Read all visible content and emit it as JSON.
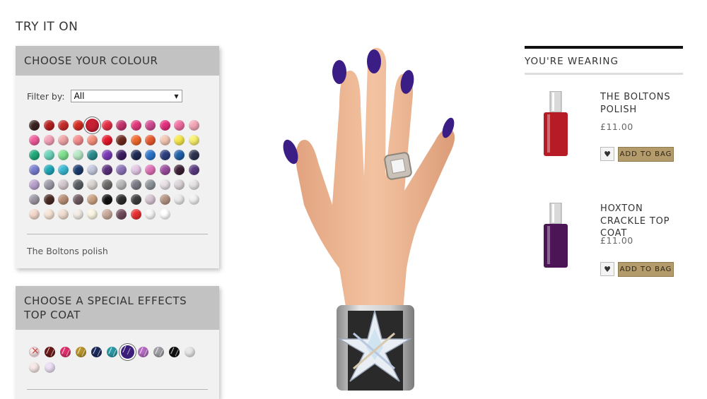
{
  "page": {
    "title": "TRY IT ON"
  },
  "colour_panel": {
    "header": "CHOOSE YOUR COLOUR",
    "filter_label": "Filter by:",
    "filter_value": "All",
    "selected_name": "The Boltons polish",
    "swatch_rows": [
      [
        "#3a2220",
        "#b51f1f",
        "#c72b2b",
        "#d42b20",
        "#c62032",
        "#e62e45",
        "#c4326d",
        "#e2397b",
        "#d04a91",
        "#e62e7e",
        "#f06d9f",
        "#f3a7b7"
      ],
      [
        "#f05b9c",
        "#f4a1b9",
        "#f0a4a6",
        "#f58c8c",
        "#f58f7a",
        "#e5172a",
        "#6d2b1e",
        "#f06a2c",
        "#e85a2e",
        "#f3c8b3",
        "#f6e84b",
        "#f9f06c"
      ],
      [
        "#1faa7a",
        "#6bd4b9",
        "#7ddf8e",
        "#b8e8c6",
        "#2a8c8e",
        "#7b3ab5",
        "#3e1c62",
        "#1d2a53",
        "#2a73c9",
        "#2c3e7e",
        "#1f5fa8",
        "#2e3450"
      ],
      [
        "#7a7ed0",
        "#1fa7b8",
        "#3ab8d2",
        "#1b3a6d",
        "#c3c8dd",
        "#5a2f7a",
        "#8c74b7",
        "#e3c7e6",
        "#e070b6",
        "#9b4d9e",
        "#3b1f35",
        "#5a3b80"
      ],
      [
        "#b9a2cf",
        "#9c9aa6",
        "#d4c8cf",
        "#5a5e63",
        "#d9d3cf",
        "#6e6a6a",
        "#b8b8b8",
        "#7b7b85",
        "#8c949a",
        "#e8e0e6",
        "#dad4d8",
        "#e7e4e4"
      ],
      [
        "#9c97a2",
        "#4a2a24",
        "#b98f75",
        "#6e5a60",
        "#cca283",
        "#111111",
        "#2c2c2c",
        "#3d3d3d",
        "#d7c6d4",
        "#b49484",
        "#eaeaea",
        "#f1f1f1"
      ],
      [
        "#f4d8cc",
        "#f6e4d7",
        "#f1ddd0",
        "#f2ede6",
        "#fbf6e2",
        "#c9aa9b",
        "#6e4a5b",
        "#e83030",
        "#f8f8f8",
        "#ffffff"
      ]
    ],
    "selected_index": [
      0,
      4
    ]
  },
  "effects_panel": {
    "header_line1": "CHOOSE A SPECIAL EFFECTS",
    "header_line2": "TOP COAT",
    "effects": [
      {
        "color": "#f7ebeb",
        "kind": "none"
      },
      {
        "color": "#6b1a1a",
        "kind": "crackle"
      },
      {
        "color": "#e0306e",
        "kind": "crackle"
      },
      {
        "color": "#b9952c",
        "kind": "crackle"
      },
      {
        "color": "#1b2a5a",
        "kind": "crackle"
      },
      {
        "color": "#2a9aa6",
        "kind": "crackle"
      },
      {
        "color": "#3a1e7a",
        "kind": "crackle",
        "selected": true
      },
      {
        "color": "#b56cc5",
        "kind": "crackle"
      },
      {
        "color": "#a0a0a6",
        "kind": "crackle"
      },
      {
        "color": "#111111",
        "kind": "crackle"
      },
      {
        "color": "#e7e7e7",
        "kind": "plain"
      },
      {
        "color": "#f7e9e6",
        "kind": "plain"
      },
      {
        "color": "#ece1f5",
        "kind": "plain"
      }
    ]
  },
  "wearing": {
    "title": "YOU'RE WEARING",
    "products": [
      {
        "name_line1": "THE BOLTONS",
        "name_line2": "POLISH",
        "name_line3": "",
        "price": "£11.00",
        "bottle_color": "#b71c26",
        "heart": "♥",
        "bag_label": "ADD TO BAG"
      },
      {
        "name_line1": "HOXTON",
        "name_line2": "CRACKLE TOP",
        "name_line3": "COAT",
        "price": "£11.00",
        "bottle_color": "#4b1556",
        "heart": "♥",
        "bag_label": "ADD TO BAG"
      }
    ]
  }
}
